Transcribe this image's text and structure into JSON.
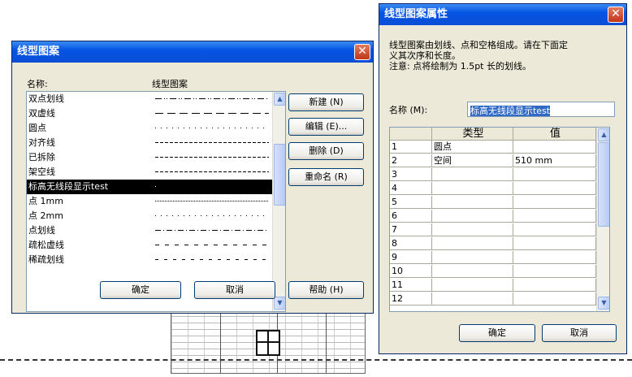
{
  "list_dialog": {
    "title": "线型图案",
    "col_name": "名称:",
    "col_pattern": "线型图案",
    "items": [
      {
        "name": "双点划线",
        "pattern": "dashdotdot"
      },
      {
        "name": "双虚线",
        "pattern": "longdash"
      },
      {
        "name": "圆点",
        "pattern": "dot"
      },
      {
        "name": "对齐线",
        "pattern": "shortdash"
      },
      {
        "name": "已拆除",
        "pattern": "shortdash"
      },
      {
        "name": "架空线",
        "pattern": "shortdash"
      },
      {
        "name": "标高无线段显示test",
        "pattern": "dot-single",
        "selected": true
      },
      {
        "name": "点 1mm",
        "pattern": "finedot"
      },
      {
        "name": "点 2mm",
        "pattern": "dot"
      },
      {
        "name": "点划线",
        "pattern": "dashdot"
      },
      {
        "name": "疏松虚线",
        "pattern": "sparsedash"
      },
      {
        "name": "稀疏划线",
        "pattern": "sparsedash2"
      }
    ],
    "btn_new": "新建 (N)",
    "btn_edit": "编辑 (E)...",
    "btn_delete": "删除 (D)",
    "btn_rename": "重命名 (R)",
    "btn_ok": "确定",
    "btn_cancel": "取消",
    "btn_help": "帮助 (H)"
  },
  "props_dialog": {
    "title": "线型图案属性",
    "desc_line1": "线型图案由划线、点和空格组成。请在下面定",
    "desc_line2": "义其次序和长度。",
    "desc_line3": "注意: 点将绘制为 1.5pt 长的划线。",
    "name_label": "名称 (M):",
    "name_value": "标高无线段显示test",
    "col_type": "类型",
    "col_value": "值",
    "rows": [
      {
        "n": "1",
        "type": "圆点",
        "value": ""
      },
      {
        "n": "2",
        "type": "空间",
        "value": "510 mm"
      },
      {
        "n": "3",
        "type": "",
        "value": ""
      },
      {
        "n": "4",
        "type": "",
        "value": ""
      },
      {
        "n": "5",
        "type": "",
        "value": ""
      },
      {
        "n": "6",
        "type": "",
        "value": ""
      },
      {
        "n": "7",
        "type": "",
        "value": ""
      },
      {
        "n": "8",
        "type": "",
        "value": ""
      },
      {
        "n": "9",
        "type": "",
        "value": ""
      },
      {
        "n": "10",
        "type": "",
        "value": ""
      },
      {
        "n": "11",
        "type": "",
        "value": ""
      },
      {
        "n": "12",
        "type": "",
        "value": ""
      }
    ],
    "btn_ok": "确定",
    "btn_cancel": "取消"
  }
}
